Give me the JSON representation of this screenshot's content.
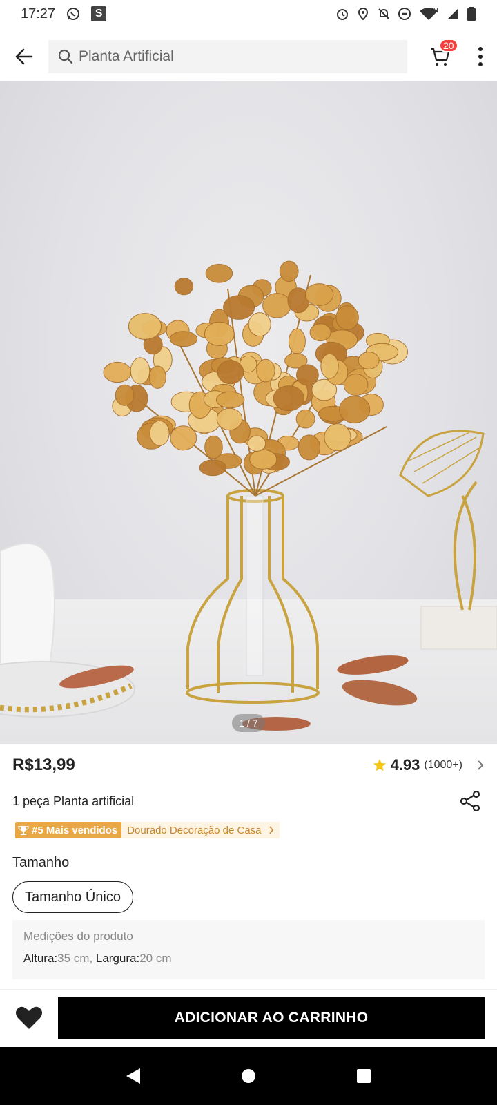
{
  "status_bar": {
    "time": "17:27",
    "icons": [
      "whatsapp-icon",
      "s-app-icon",
      "alarm-icon",
      "location-icon",
      "notifications-off-icon",
      "do-not-disturb-icon",
      "wifi-icon",
      "signal-icon",
      "battery-icon"
    ],
    "s_label": "S",
    "network_label": "H"
  },
  "header": {
    "search_text": "Planta Artificial",
    "cart_count": "20"
  },
  "gallery": {
    "counter": "1 / 7"
  },
  "product": {
    "price": "R$13,99",
    "rating": "4.93",
    "rating_count": "(1000+)",
    "title": "1 peça Planta artificial",
    "rank_badge": "#5 Mais vendidos",
    "rank_category": "Dourado Decoração de Casa"
  },
  "size": {
    "label": "Tamanho",
    "options": [
      "Tamanho Único"
    ]
  },
  "measurements": {
    "title": "Medições do produto",
    "height_label": "Altura:",
    "height_value": "35 cm",
    "separator": ", ",
    "width_label": "Largura:",
    "width_value": "20 cm"
  },
  "actions": {
    "add_to_cart": "ADICIONAR AO CARRINHO"
  },
  "colors": {
    "accent_black": "#000000",
    "badge_red": "#f3413e",
    "rank_gold": "#e9a845",
    "rating_star": "#f5c518"
  }
}
